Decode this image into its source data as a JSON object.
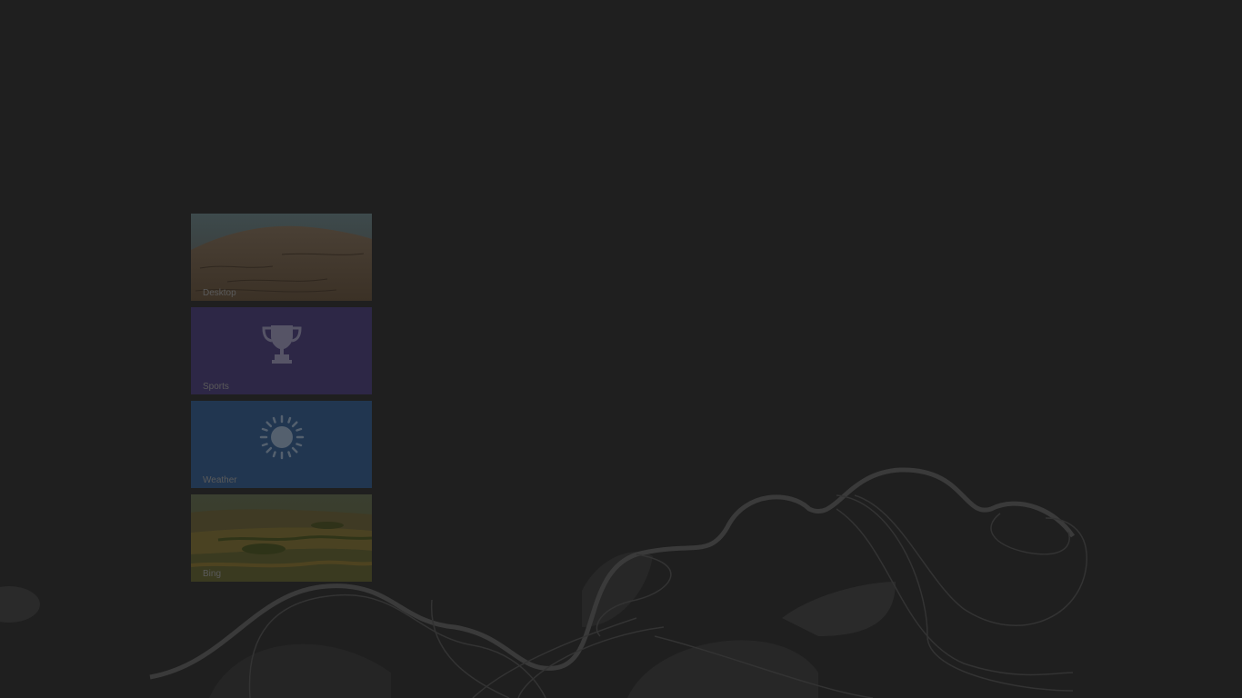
{
  "start_screen": {
    "tiles": [
      {
        "label": "Desktop",
        "icon": "desert-landscape-image"
      },
      {
        "label": "Sports",
        "icon": "trophy-icon",
        "color": "#2d2746"
      },
      {
        "label": "Weather",
        "icon": "sun-icon",
        "color": "#213650"
      },
      {
        "label": "Bing",
        "icon": "farmland-landscape-image"
      }
    ],
    "background_color": "#1f1f1f"
  }
}
